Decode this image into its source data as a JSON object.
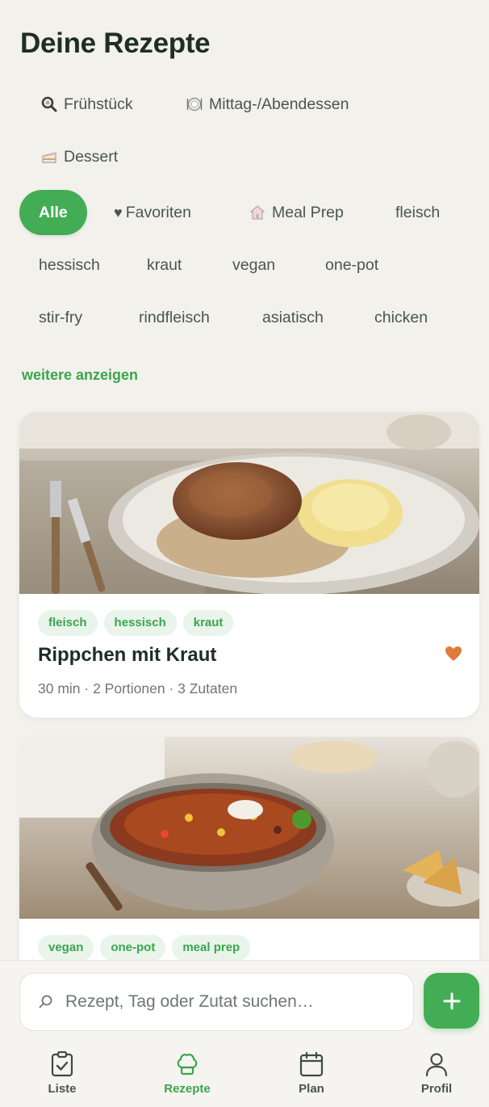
{
  "header": {
    "title": "Deine Rezepte"
  },
  "categories": [
    {
      "label": "Frühstück",
      "icon": "magnifier-icon"
    },
    {
      "label": "Mittag-/Abendessen",
      "icon": "plate-icon"
    },
    {
      "label": "Dessert",
      "icon": "cake-icon"
    }
  ],
  "filters": [
    {
      "label": "Alle",
      "active": true
    },
    {
      "label": "Favoriten",
      "icon": "heart-icon"
    },
    {
      "label": "Meal Prep",
      "icon": "house-icon"
    },
    {
      "label": "fleisch"
    },
    {
      "label": "hessisch"
    },
    {
      "label": "kraut"
    },
    {
      "label": "vegan"
    },
    {
      "label": "one-pot"
    },
    {
      "label": "stir-fry"
    },
    {
      "label": "rindfleisch"
    },
    {
      "label": "asiatisch"
    },
    {
      "label": "chicken"
    }
  ],
  "more_label": "weitere anzeigen",
  "recipes": [
    {
      "tags": [
        "fleisch",
        "hessisch",
        "kraut"
      ],
      "title": "Rippchen mit Kraut",
      "meta": "30 min · 2 Portionen · 3 Zutaten",
      "favorite": true
    },
    {
      "tags": [
        "vegan",
        "one-pot",
        "meal prep"
      ]
    }
  ],
  "search": {
    "placeholder": "Rezept, Tag oder Zutat suchen…",
    "value": ""
  },
  "nav": {
    "items": [
      {
        "label": "Liste",
        "icon": "clipboard-check-icon"
      },
      {
        "label": "Rezepte",
        "icon": "chef-hat-icon",
        "active": true
      },
      {
        "label": "Plan",
        "icon": "calendar-icon"
      },
      {
        "label": "Profil",
        "icon": "user-icon"
      }
    ]
  },
  "colors": {
    "accent": "#43ad55",
    "background": "#f2f1ec",
    "heart": "#e07a3e"
  }
}
